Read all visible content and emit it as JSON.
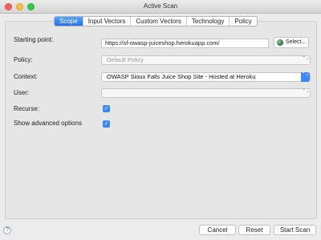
{
  "window": {
    "title": "Active Scan"
  },
  "tabs": [
    {
      "label": "Scope",
      "active": true
    },
    {
      "label": "Input Vectors",
      "active": false
    },
    {
      "label": "Custom Vectors",
      "active": false
    },
    {
      "label": "Technology",
      "active": false
    },
    {
      "label": "Policy",
      "active": false
    }
  ],
  "form": {
    "starting_point": {
      "label": "Starting point:",
      "value": "https://sf-owasp-juiceshop.herokuapp.com/"
    },
    "select_button": {
      "label": "Select..."
    },
    "policy": {
      "label": "Policy:",
      "value": "Default Policy"
    },
    "context": {
      "label": "Context:",
      "value": "OWASP Sioux Falls Juice Shop Site - Hosted at Heroku"
    },
    "user": {
      "label": "User:",
      "value": ""
    },
    "recurse": {
      "label": "Recurse:",
      "checked": true
    },
    "show_advanced": {
      "label": "Show advanced options",
      "checked": true
    }
  },
  "footer": {
    "cancel": "Cancel",
    "reset": "Reset",
    "start": "Start Scan",
    "help_glyph": "?"
  },
  "icons": {
    "check_glyph": "✓",
    "stepper_glyph": "⌃⌄"
  },
  "colors": {
    "accent": "#2571ea",
    "checkbox": "#3a89f5"
  }
}
